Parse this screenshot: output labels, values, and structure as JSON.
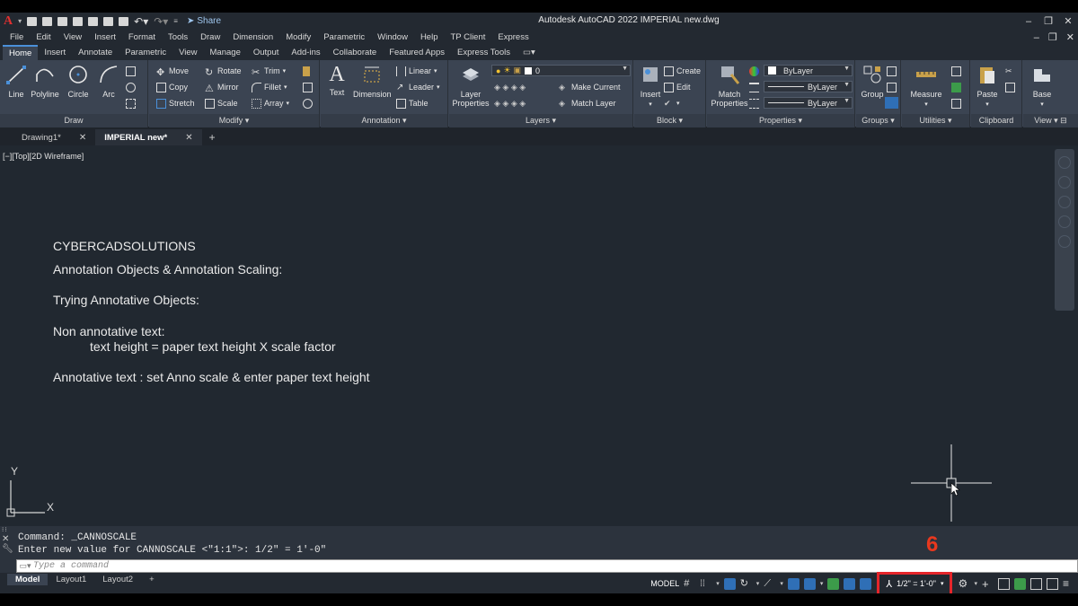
{
  "titlebar": {
    "share_label": "Share",
    "title": "Autodesk AutoCAD 2022   IMPERIAL new.dwg"
  },
  "menubar": {
    "items": [
      "File",
      "Edit",
      "View",
      "Insert",
      "Format",
      "Tools",
      "Draw",
      "Dimension",
      "Modify",
      "Parametric",
      "Window",
      "Help",
      "TP Client",
      "Express"
    ]
  },
  "ribbon_tabs": [
    "Home",
    "Insert",
    "Annotate",
    "Parametric",
    "View",
    "Manage",
    "Output",
    "Add-ins",
    "Collaborate",
    "Featured Apps",
    "Express Tools"
  ],
  "ribbon": {
    "draw": {
      "title": "Draw",
      "line": "Line",
      "polyline": "Polyline",
      "circle": "Circle",
      "arc": "Arc"
    },
    "modify": {
      "title": "Modify",
      "move": "Move",
      "rotate": "Rotate",
      "trim": "Trim",
      "copy": "Copy",
      "mirror": "Mirror",
      "fillet": "Fillet",
      "stretch": "Stretch",
      "scale": "Scale",
      "array": "Array"
    },
    "annotation": {
      "title": "Annotation",
      "text": "Text",
      "dimension": "Dimension",
      "linear": "Linear",
      "leader": "Leader",
      "table": "Table"
    },
    "layers": {
      "title": "Layers",
      "properties": "Layer Properties",
      "current_layer": "0",
      "make_current": "Make Current",
      "match_layer": "Match Layer"
    },
    "block": {
      "title": "Block",
      "insert": "Insert",
      "create": "Create",
      "edit": "Edit"
    },
    "properties": {
      "title": "Properties",
      "match": "Match Properties",
      "color": "ByLayer",
      "linetype": "ByLayer",
      "lineweight": "ByLayer"
    },
    "groups": {
      "title": "Groups",
      "group": "Group"
    },
    "utilities": {
      "title": "Utilities",
      "measure": "Measure"
    },
    "clipboard": {
      "title": "Clipboard",
      "paste": "Paste"
    },
    "view": {
      "title": "View",
      "base": "Base"
    }
  },
  "file_tabs": [
    {
      "label": "Drawing1*"
    },
    {
      "label": "IMPERIAL new*"
    }
  ],
  "viewport_label": "[−][Top][2D Wireframe]",
  "drawing_text": {
    "line1": "CYBERCADSOLUTIONS",
    "line2": "Annotation Objects & Annotation Scaling:",
    "line3": "Trying Annotative Objects:",
    "line4": "Non annotative text:",
    "line5": "text height = paper text height X scale factor",
    "line6": "Annotative text : set Anno scale & enter paper text height"
  },
  "ucs": {
    "x": "X",
    "y": "Y"
  },
  "command": {
    "line1": "Command: _CANNOSCALE",
    "line2": "Enter new value for CANNOSCALE <\"1:1\">: 1/2\" = 1'-0\"",
    "placeholder": "Type a command"
  },
  "layout_tabs": [
    "Model",
    "Layout1",
    "Layout2"
  ],
  "status": {
    "model": "MODEL",
    "annotation_scale": "1/2\" = 1'-0\""
  },
  "callout": "6",
  "colors": {
    "accent": "#4a90d9",
    "highlight": "#e5252a",
    "callout": "#e8381e"
  }
}
